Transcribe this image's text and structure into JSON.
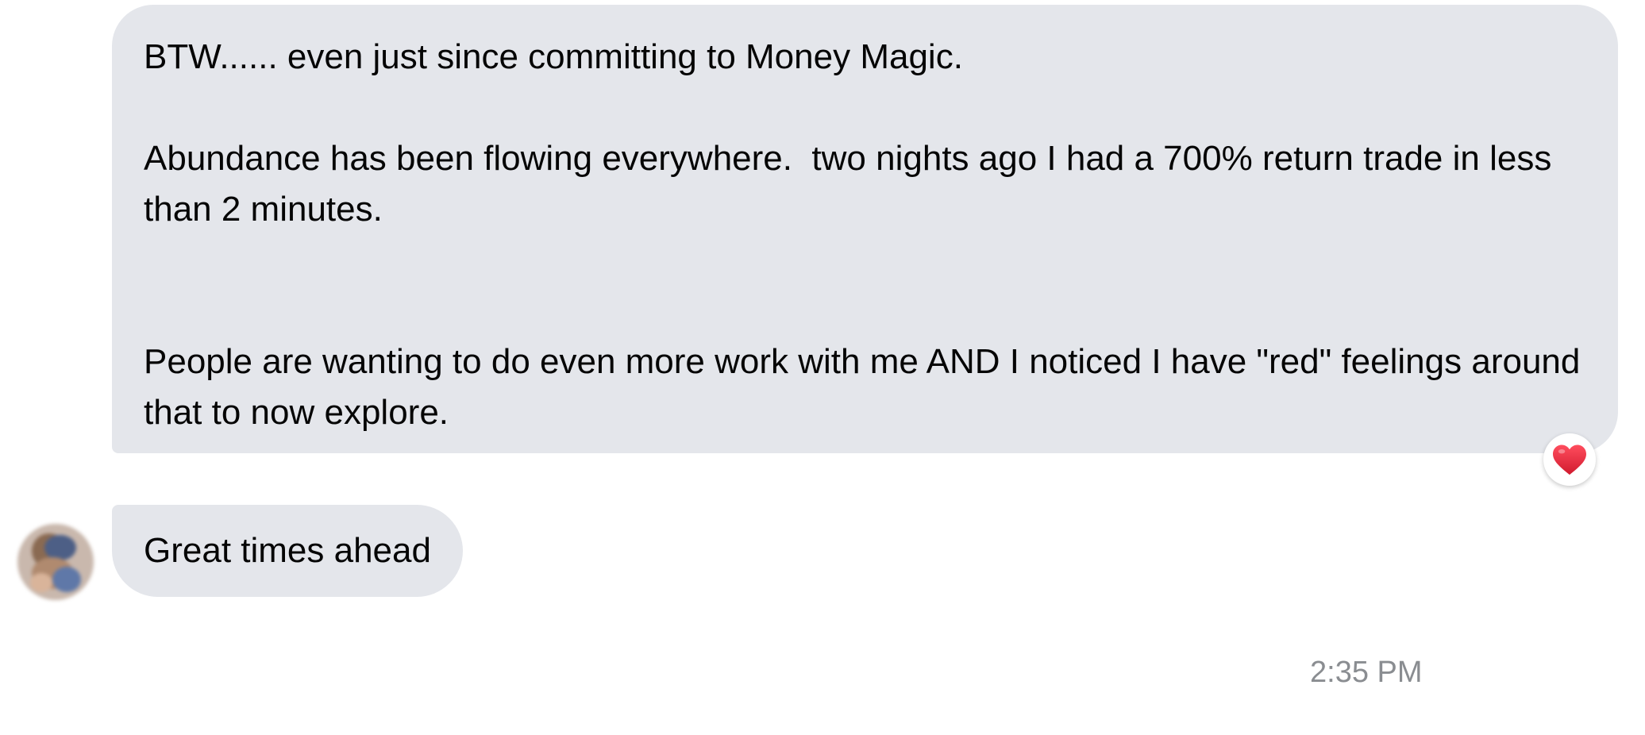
{
  "messages": [
    {
      "paragraphs": [
        "BTW...... even just since committing to Money Magic.",
        "Abundance has been flowing everywhere.  two nights ago I had a 700% return trade in less than 2 minutes.",
        "People are wanting to do even more work with me AND I noticed I have \"red\" feelings around that to now explore."
      ],
      "reaction": "heart-icon"
    },
    {
      "text": "Great times ahead"
    }
  ],
  "timestamp": "2:35 PM",
  "colors": {
    "bubble_bg": "#e4e6eb",
    "text": "#050505",
    "timestamp": "#8a8d91",
    "heart": "#e0243a"
  }
}
